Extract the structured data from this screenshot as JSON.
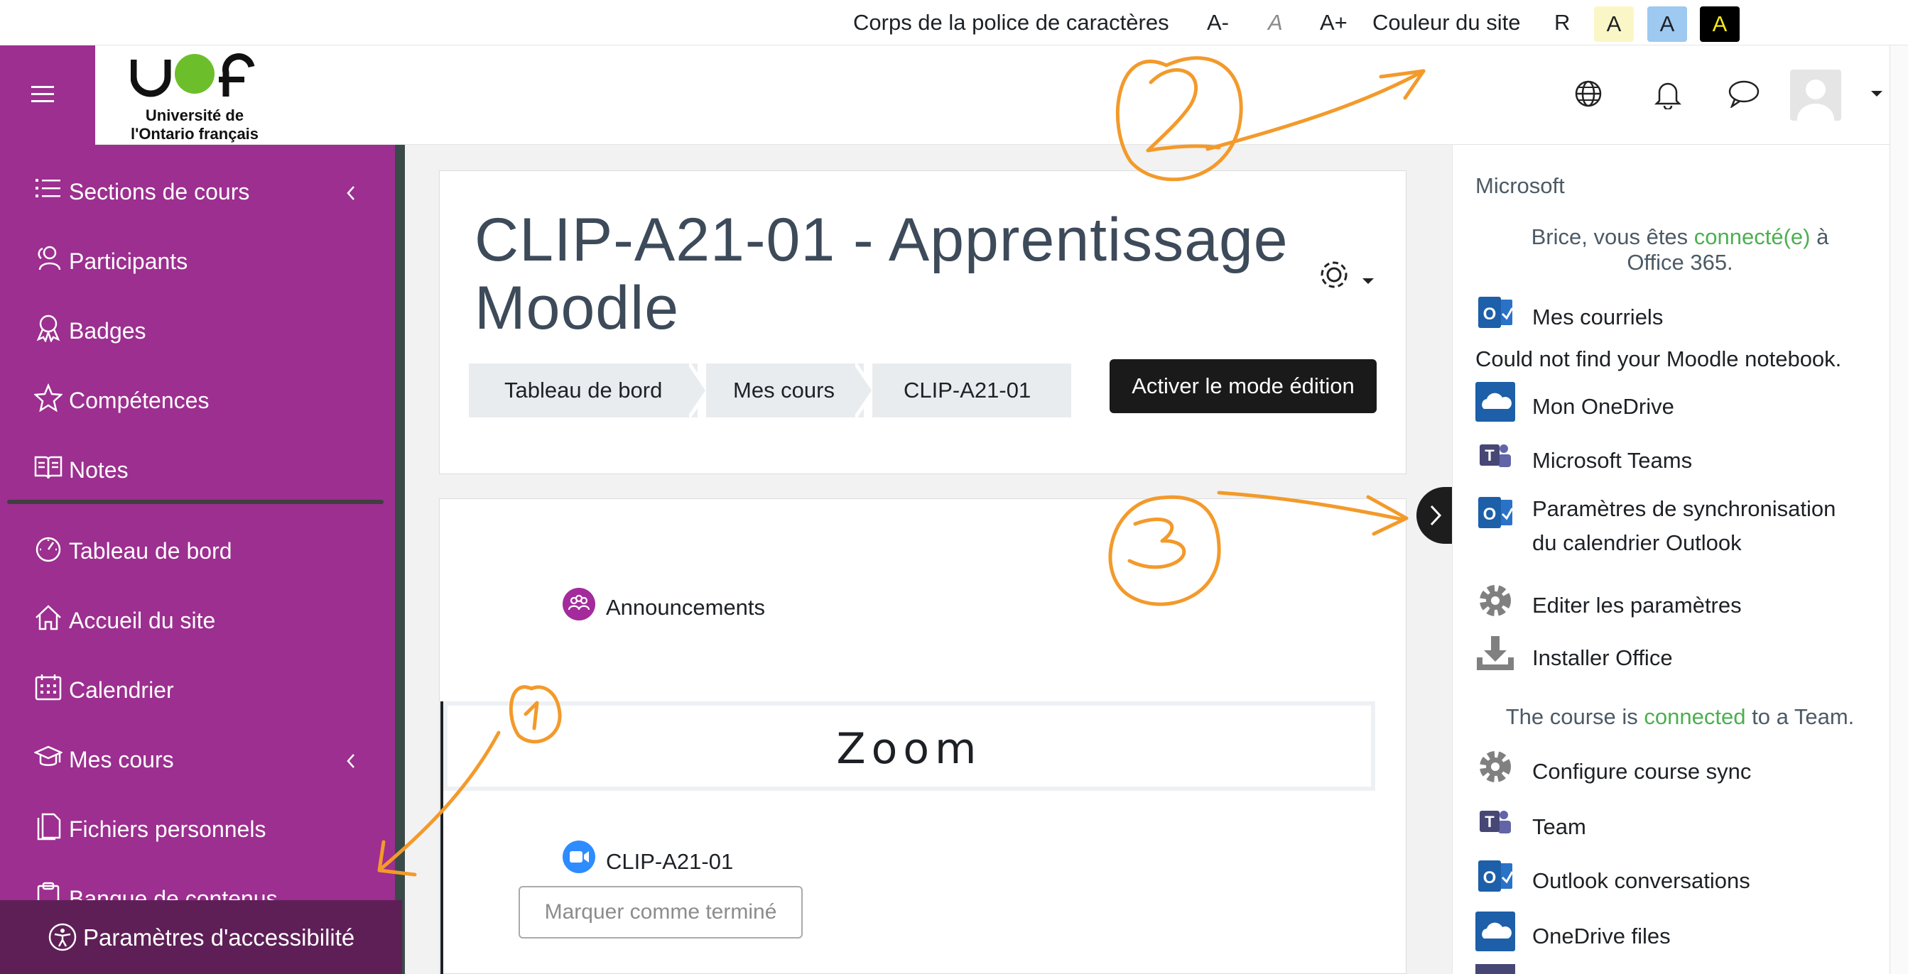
{
  "accessibility_bar": {
    "font_label": "Corps de la police de caractères",
    "font_decrease": "A-",
    "font_reset": "A",
    "font_increase": "A+",
    "color_label": "Couleur du site",
    "color_reset": "R",
    "color_yellow": "A",
    "color_blue": "A",
    "color_black": "A"
  },
  "header": {
    "logo_text": "UOF",
    "logo_subtitle": "Université de\nl'Ontario français",
    "icons": [
      "hamburger-icon",
      "language-globe-icon",
      "bell-icon",
      "chat-icon",
      "user-avatar",
      "caret-down-icon"
    ]
  },
  "nav": {
    "items": [
      {
        "label": "Sections de cours",
        "icon": "list-icon",
        "has_submenu": true
      },
      {
        "label": "Participants",
        "icon": "users-icon"
      },
      {
        "label": "Badges",
        "icon": "badge-icon"
      },
      {
        "label": "Compétences",
        "icon": "star-icon"
      },
      {
        "label": "Notes",
        "icon": "book-icon"
      },
      {
        "label": "Tableau de bord",
        "icon": "dashboard-icon"
      },
      {
        "label": "Accueil du site",
        "icon": "home-icon"
      },
      {
        "label": "Calendrier",
        "icon": "calendar-icon"
      },
      {
        "label": "Mes cours",
        "icon": "graduation-cap-icon",
        "has_submenu": true
      },
      {
        "label": "Fichiers personnels",
        "icon": "file-icon"
      },
      {
        "label": "Banque de contenus",
        "icon": "clipboard-icon"
      }
    ],
    "accessibility_settings": "Paramètres d'accessibilité"
  },
  "course": {
    "title_line1": "CLIP-A21-01 - Apprentissage",
    "title_line2": "Moodle",
    "breadcrumbs": [
      "Tableau de bord",
      "Mes cours",
      "CLIP-A21-01"
    ],
    "edit_button": "Activer le mode édition",
    "announcements": "Announcements",
    "section_title": "Zoom",
    "zoom_activity": "CLIP-A21-01",
    "mark_done": "Marquer comme terminé"
  },
  "microsoft": {
    "heading": "Microsoft",
    "connected_prefix": "Brice, vous êtes ",
    "connected_word": "connecté(e)",
    "connected_suffix": " à",
    "connected_line2": "Office 365.",
    "notebook_msg": "Could not find your Moodle notebook.",
    "team_prefix": "The course is ",
    "team_word": "connected",
    "team_suffix": " to a Team.",
    "links": [
      {
        "label": "Mes courriels",
        "icon": "outlook-icon"
      },
      {
        "label": "Mon OneDrive",
        "icon": "onedrive-icon"
      },
      {
        "label": "Microsoft Teams",
        "icon": "teams-icon"
      },
      {
        "label": "Paramètres de synchronisation",
        "label2": "du calendrier Outlook",
        "icon": "outlook-icon"
      },
      {
        "label": "Editer les paramètres",
        "icon": "gear-icon"
      },
      {
        "label": "Installer Office",
        "icon": "download-icon"
      },
      {
        "label": "Configure course sync",
        "icon": "gear-icon"
      },
      {
        "label": "Team",
        "icon": "teams-icon"
      },
      {
        "label": "Outlook conversations",
        "icon": "outlook-icon"
      },
      {
        "label": "OneDrive files",
        "icon": "onedrive-icon"
      }
    ]
  },
  "annotations": {
    "one": "1",
    "two": "2",
    "three": "3"
  },
  "colors": {
    "brand": "#9c2f8f",
    "brand_dark": "#5e1f56",
    "annotation": "#f39a2b",
    "success": "#4caf50"
  }
}
